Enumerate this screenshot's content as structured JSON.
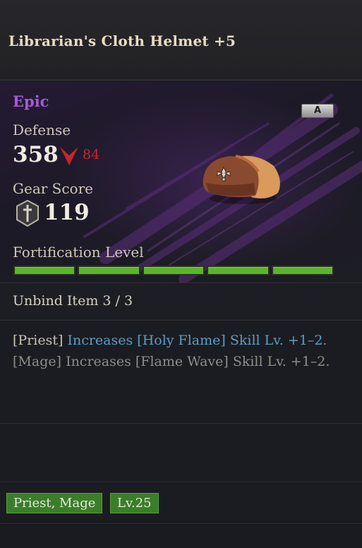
{
  "item": {
    "name": "Librarian's Cloth Helmet +5",
    "rarity": "Epic",
    "rarity_color": "#a659d8",
    "grade_badge": "A",
    "image_icon": "leather-cap-icon"
  },
  "stats": {
    "defense_label": "Defense",
    "defense_value": "358",
    "defense_change_icon": "down-arrow-icon",
    "defense_change": "84",
    "defense_change_color": "#c8262a",
    "gear_score_label": "Gear Score",
    "gear_score_icon": "sword-shield-icon",
    "gear_score_value": "119"
  },
  "fortification": {
    "label": "Fortification Level",
    "filled": 5,
    "total": 5,
    "bar_color": "#5bb52c"
  },
  "unbind": {
    "text": "Unbind Item 3 / 3"
  },
  "effects": [
    {
      "class": "[Priest]",
      "text": "Increases [Holy Flame] Skill Lv. +1–2.",
      "active": true,
      "color": "#5b9ec6"
    },
    {
      "class": "[Mage]",
      "text": "Increases [Flame Wave] Skill Lv. +1–2.",
      "active": false,
      "color": "#8e8d8a"
    }
  ],
  "tags": {
    "classes": "Priest, Mage",
    "level": "Lv.25",
    "tag_color": "#3b7d2a"
  }
}
